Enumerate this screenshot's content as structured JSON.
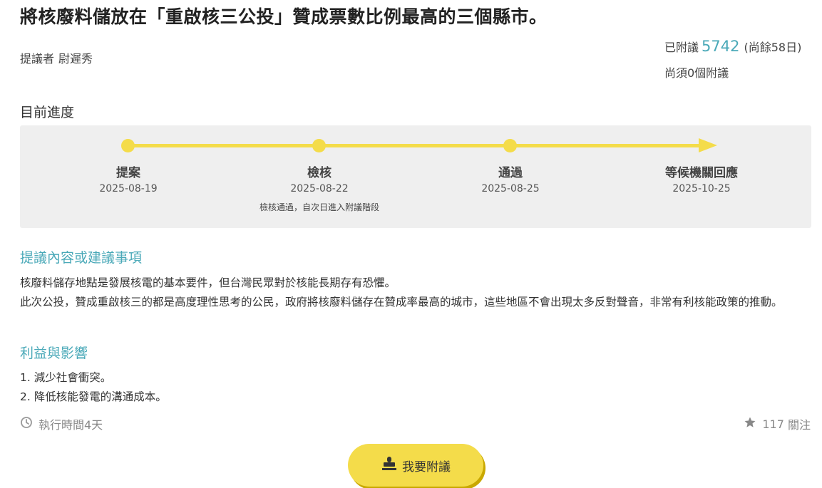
{
  "title": "將核廢料儲放在「重啟核三公投」贊成票數比例最高的三個縣市。",
  "proposer": {
    "label": "提議者",
    "name": "尉遲秀"
  },
  "endorse": {
    "prefix": "已附議",
    "count": "5742",
    "remaining_days": "(尚餘58日)",
    "needed": "尚須0個附議"
  },
  "progress": {
    "heading": "目前進度",
    "stages": [
      {
        "name": "提案",
        "date": "2025-08-19",
        "note": ""
      },
      {
        "name": "檢核",
        "date": "2025-08-22",
        "note": "檢核通過，自次日進入附議階段"
      },
      {
        "name": "通過",
        "date": "2025-08-25",
        "note": ""
      },
      {
        "name": "等候機關回應",
        "date": "2025-10-25",
        "note": ""
      }
    ],
    "track_color": "#f4dc4a"
  },
  "sections": {
    "proposal": {
      "title": "提議內容或建議事項",
      "paragraphs": [
        "核廢料儲存地點是發展核電的基本要件，但台灣民眾對於核能長期存有恐懼。",
        "此次公投，贊成重啟核三的都是高度理性思考的公民，政府將核廢料儲存在贊成率最高的城市，這些地區不會出現太多反對聲音，非常有利核能政策的推動。"
      ]
    },
    "benefits": {
      "title": "利益與影響",
      "items": [
        "1. 減少社會衝突。",
        "2. 降低核能發電的溝通成本。"
      ]
    }
  },
  "footer": {
    "duration": "執行時間4天",
    "follow_count": "117",
    "follow_label": "關注"
  },
  "button": {
    "label": "我要附議"
  },
  "icons": {
    "clock": "clock-icon",
    "star": "star-icon",
    "stamp": "stamp-icon"
  },
  "colors": {
    "accent": "#4aa9b8",
    "yellow": "#f4dc4a",
    "box_bg": "#efefef"
  }
}
